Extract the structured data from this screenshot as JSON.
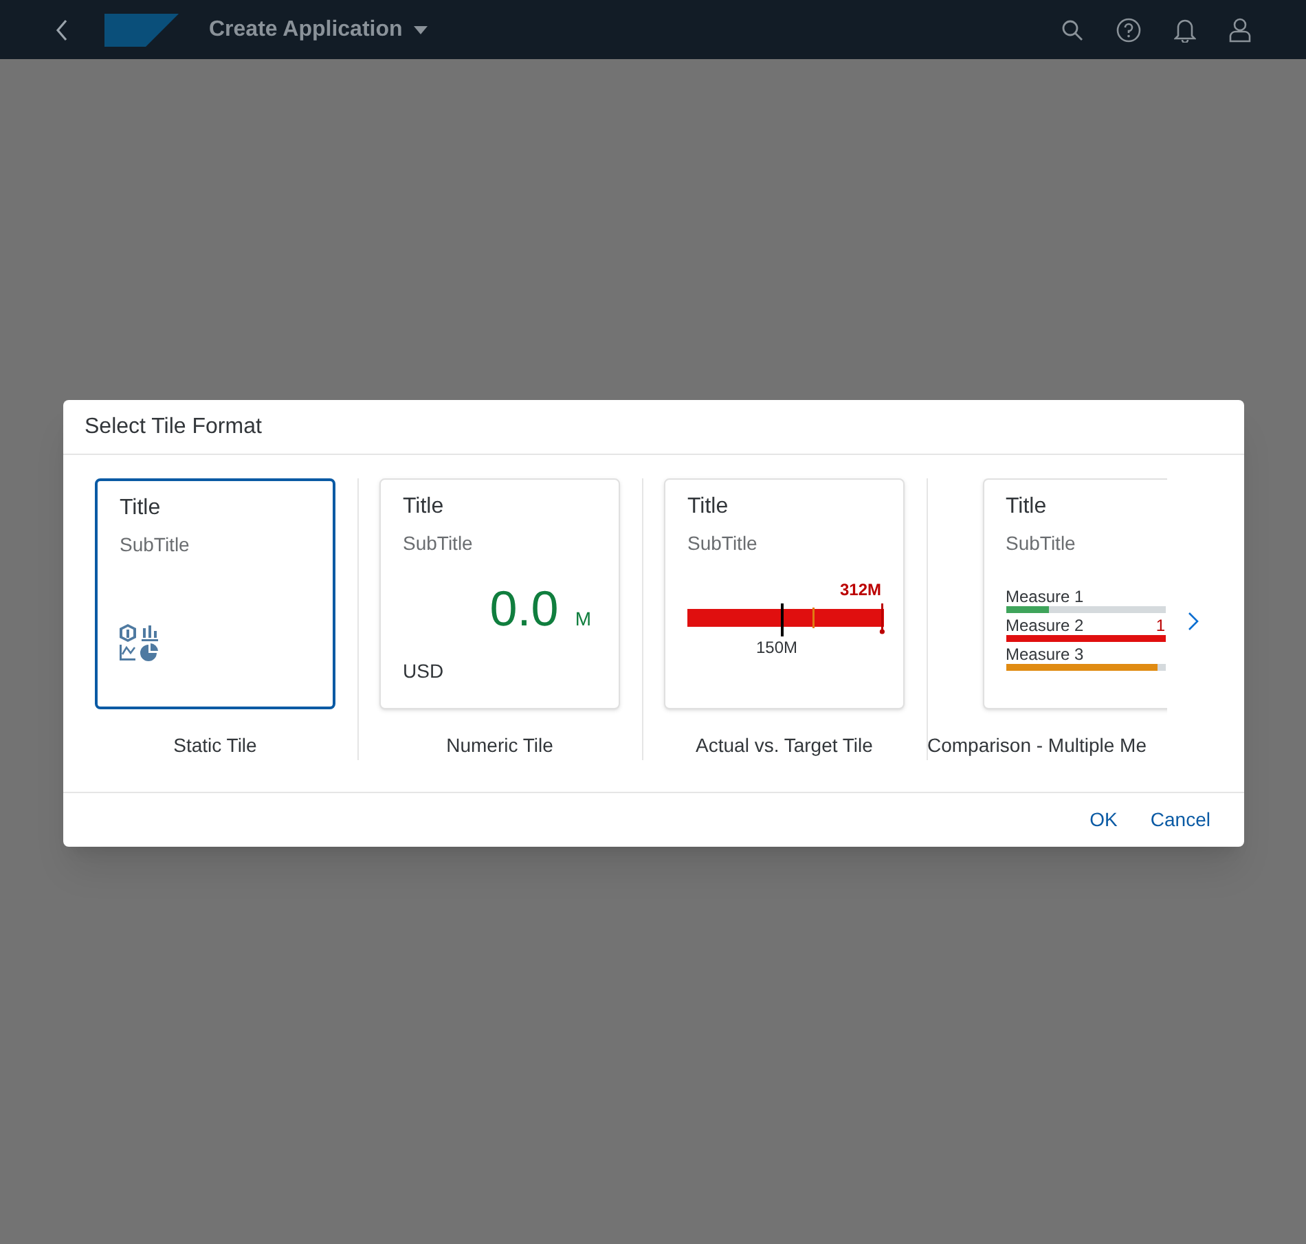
{
  "shell": {
    "title": "Create Application"
  },
  "dialog": {
    "title": "Select Tile Format",
    "tiles": [
      {
        "kind": "static",
        "selected": true,
        "title": "Title",
        "subtitle": "SubTitle",
        "label": "Static Tile"
      },
      {
        "kind": "numeric",
        "selected": false,
        "title": "Title",
        "subtitle": "SubTitle",
        "value": "0.0",
        "scale": "M",
        "unit": "USD",
        "label": "Numeric Tile"
      },
      {
        "kind": "bullet",
        "selected": false,
        "title": "Title",
        "subtitle": "SubTitle",
        "actual": "312M",
        "target": "150M",
        "label": "Actual vs. Target Tile"
      },
      {
        "kind": "comparison",
        "selected": false,
        "title": "Title",
        "subtitle": "SubTitle",
        "label": "Comparison - Multiple Me",
        "measures": [
          {
            "name": "Measure 1",
            "level": 0.27,
            "color": "#3fa45b"
          },
          {
            "name": "Measure 2",
            "level": 1,
            "color": "#e00f0f",
            "value": "1"
          },
          {
            "name": "Measure 3",
            "level": 0.95,
            "color": "#e08b12"
          }
        ]
      }
    ],
    "buttons": [
      "OK",
      "Cancel"
    ]
  }
}
